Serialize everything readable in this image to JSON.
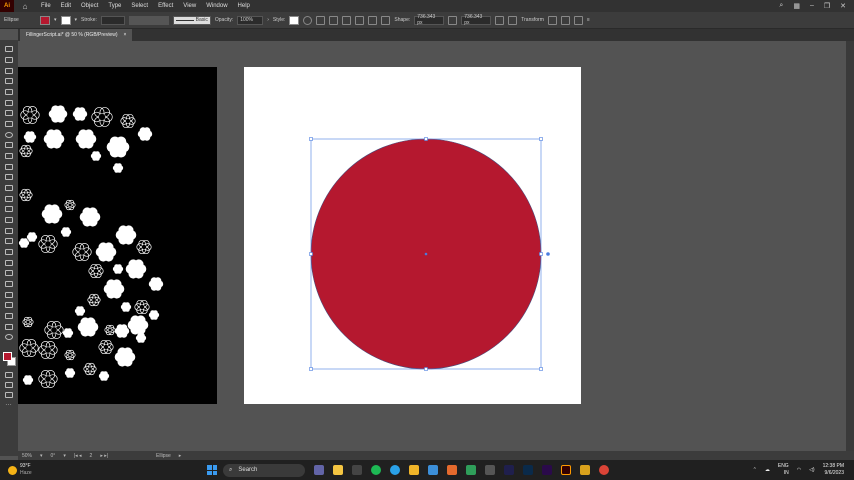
{
  "menubar": {
    "app_logo": "Ai",
    "items": [
      "File",
      "Edit",
      "Object",
      "Type",
      "Select",
      "Effect",
      "View",
      "Window",
      "Help"
    ]
  },
  "control": {
    "object_type": "Ellipse",
    "stroke_label": "Stroke:",
    "brush_label": "Basic",
    "opacity_label": "Opacity:",
    "opacity_value": "100%",
    "style_label": "Style:",
    "shape_label": "Shape:",
    "width_value": "736.343 px",
    "height_value": "736.343 px",
    "transform_label": "Transform",
    "fill_color": "#b5182f"
  },
  "document": {
    "tab_title": "FillingerScript.ai* @ 50 % (RGB/Preview)",
    "close": "×"
  },
  "status": {
    "zoom": "50%",
    "rotation": "0°",
    "artboard": "2",
    "tool_name": "Ellipse"
  },
  "taskbar": {
    "temperature": "93°F",
    "weather_text": "Haze",
    "search_placeholder": "Search",
    "language_line1": "ENG",
    "language_line2": "IN",
    "time": "12:38 PM",
    "date": "9/6/2023"
  },
  "artwork": {
    "circle_color": "#b5182f",
    "flower_color": "#ffffff",
    "selection_color": "#4a7de0"
  }
}
